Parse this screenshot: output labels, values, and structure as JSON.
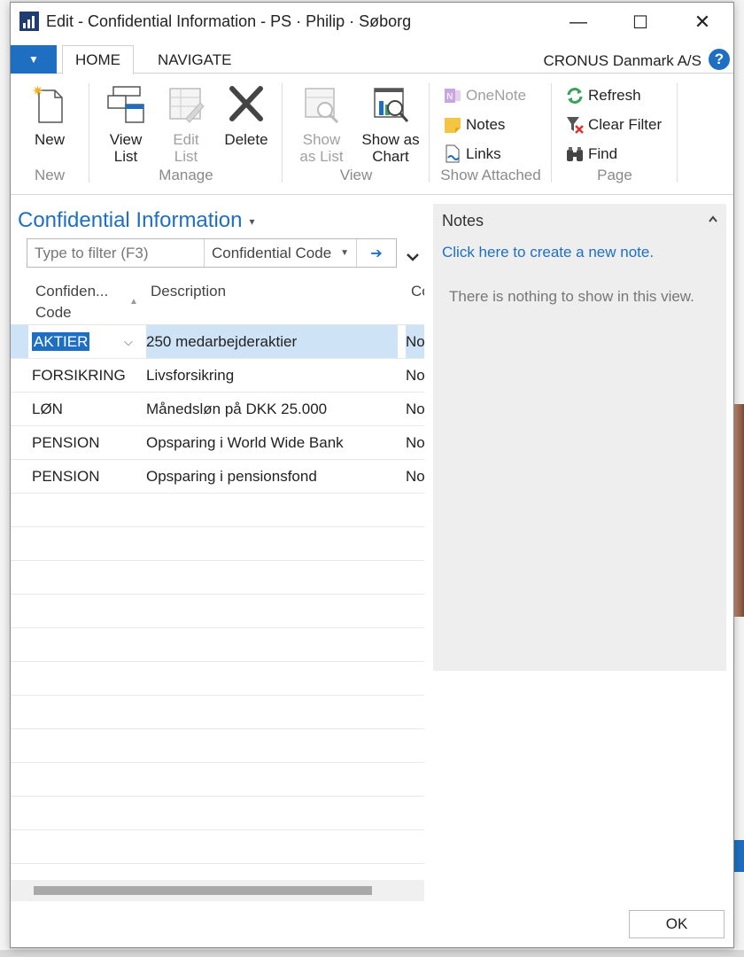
{
  "window": {
    "title": "Edit - Confidential Information - PS · Philip · Søborg",
    "minimize_glyph": "—",
    "maximize_glyph": "☐",
    "close_glyph": "✕"
  },
  "ribbon_tabs": {
    "home": "HOME",
    "navigate": "NAVIGATE"
  },
  "company": "CRONUS Danmark A/S",
  "help_glyph": "?",
  "ribbon": {
    "new_group": {
      "label": "New",
      "new_btn": "New"
    },
    "manage_group": {
      "label": "Manage",
      "view_list": "View List",
      "edit_list": "Edit List",
      "delete": "Delete"
    },
    "view_group": {
      "label": "View",
      "show_as_list": "Show as List",
      "show_as_chart": "Show as Chart"
    },
    "show_attached_group": {
      "label": "Show Attached",
      "onenote": "OneNote",
      "notes": "Notes",
      "links": "Links"
    },
    "page_group": {
      "label": "Page",
      "refresh": "Refresh",
      "clear_filter": "Clear Filter",
      "find": "Find"
    }
  },
  "list": {
    "title": "Confidential Information",
    "filter_placeholder": "Type to filter (F3)",
    "filter_field": "Confidential Code",
    "columns": {
      "code_line1": "Confiden...",
      "code_line2": "Code",
      "description": "Description",
      "third": "Co"
    },
    "rows": [
      {
        "code": "AKTIER",
        "description": "250 medarbejderaktier",
        "third": "No"
      },
      {
        "code": "FORSIKRING",
        "description": "Livsforsikring",
        "third": "No"
      },
      {
        "code": "LØN",
        "description": "Månedsløn på DKK 25.000",
        "third": "No"
      },
      {
        "code": "PENSION",
        "description": "Opsparing i World Wide Bank",
        "third": "No"
      },
      {
        "code": "PENSION",
        "description": "Opsparing i pensionsfond",
        "third": "No"
      }
    ]
  },
  "notes": {
    "title": "Notes",
    "create_link": "Click here to create a new note.",
    "empty_text": "There is nothing to show in this view."
  },
  "ok_label": "OK",
  "colors": {
    "accent": "#1e6fc2",
    "selection": "#cfe3f6",
    "pane": "#eeeeee"
  }
}
